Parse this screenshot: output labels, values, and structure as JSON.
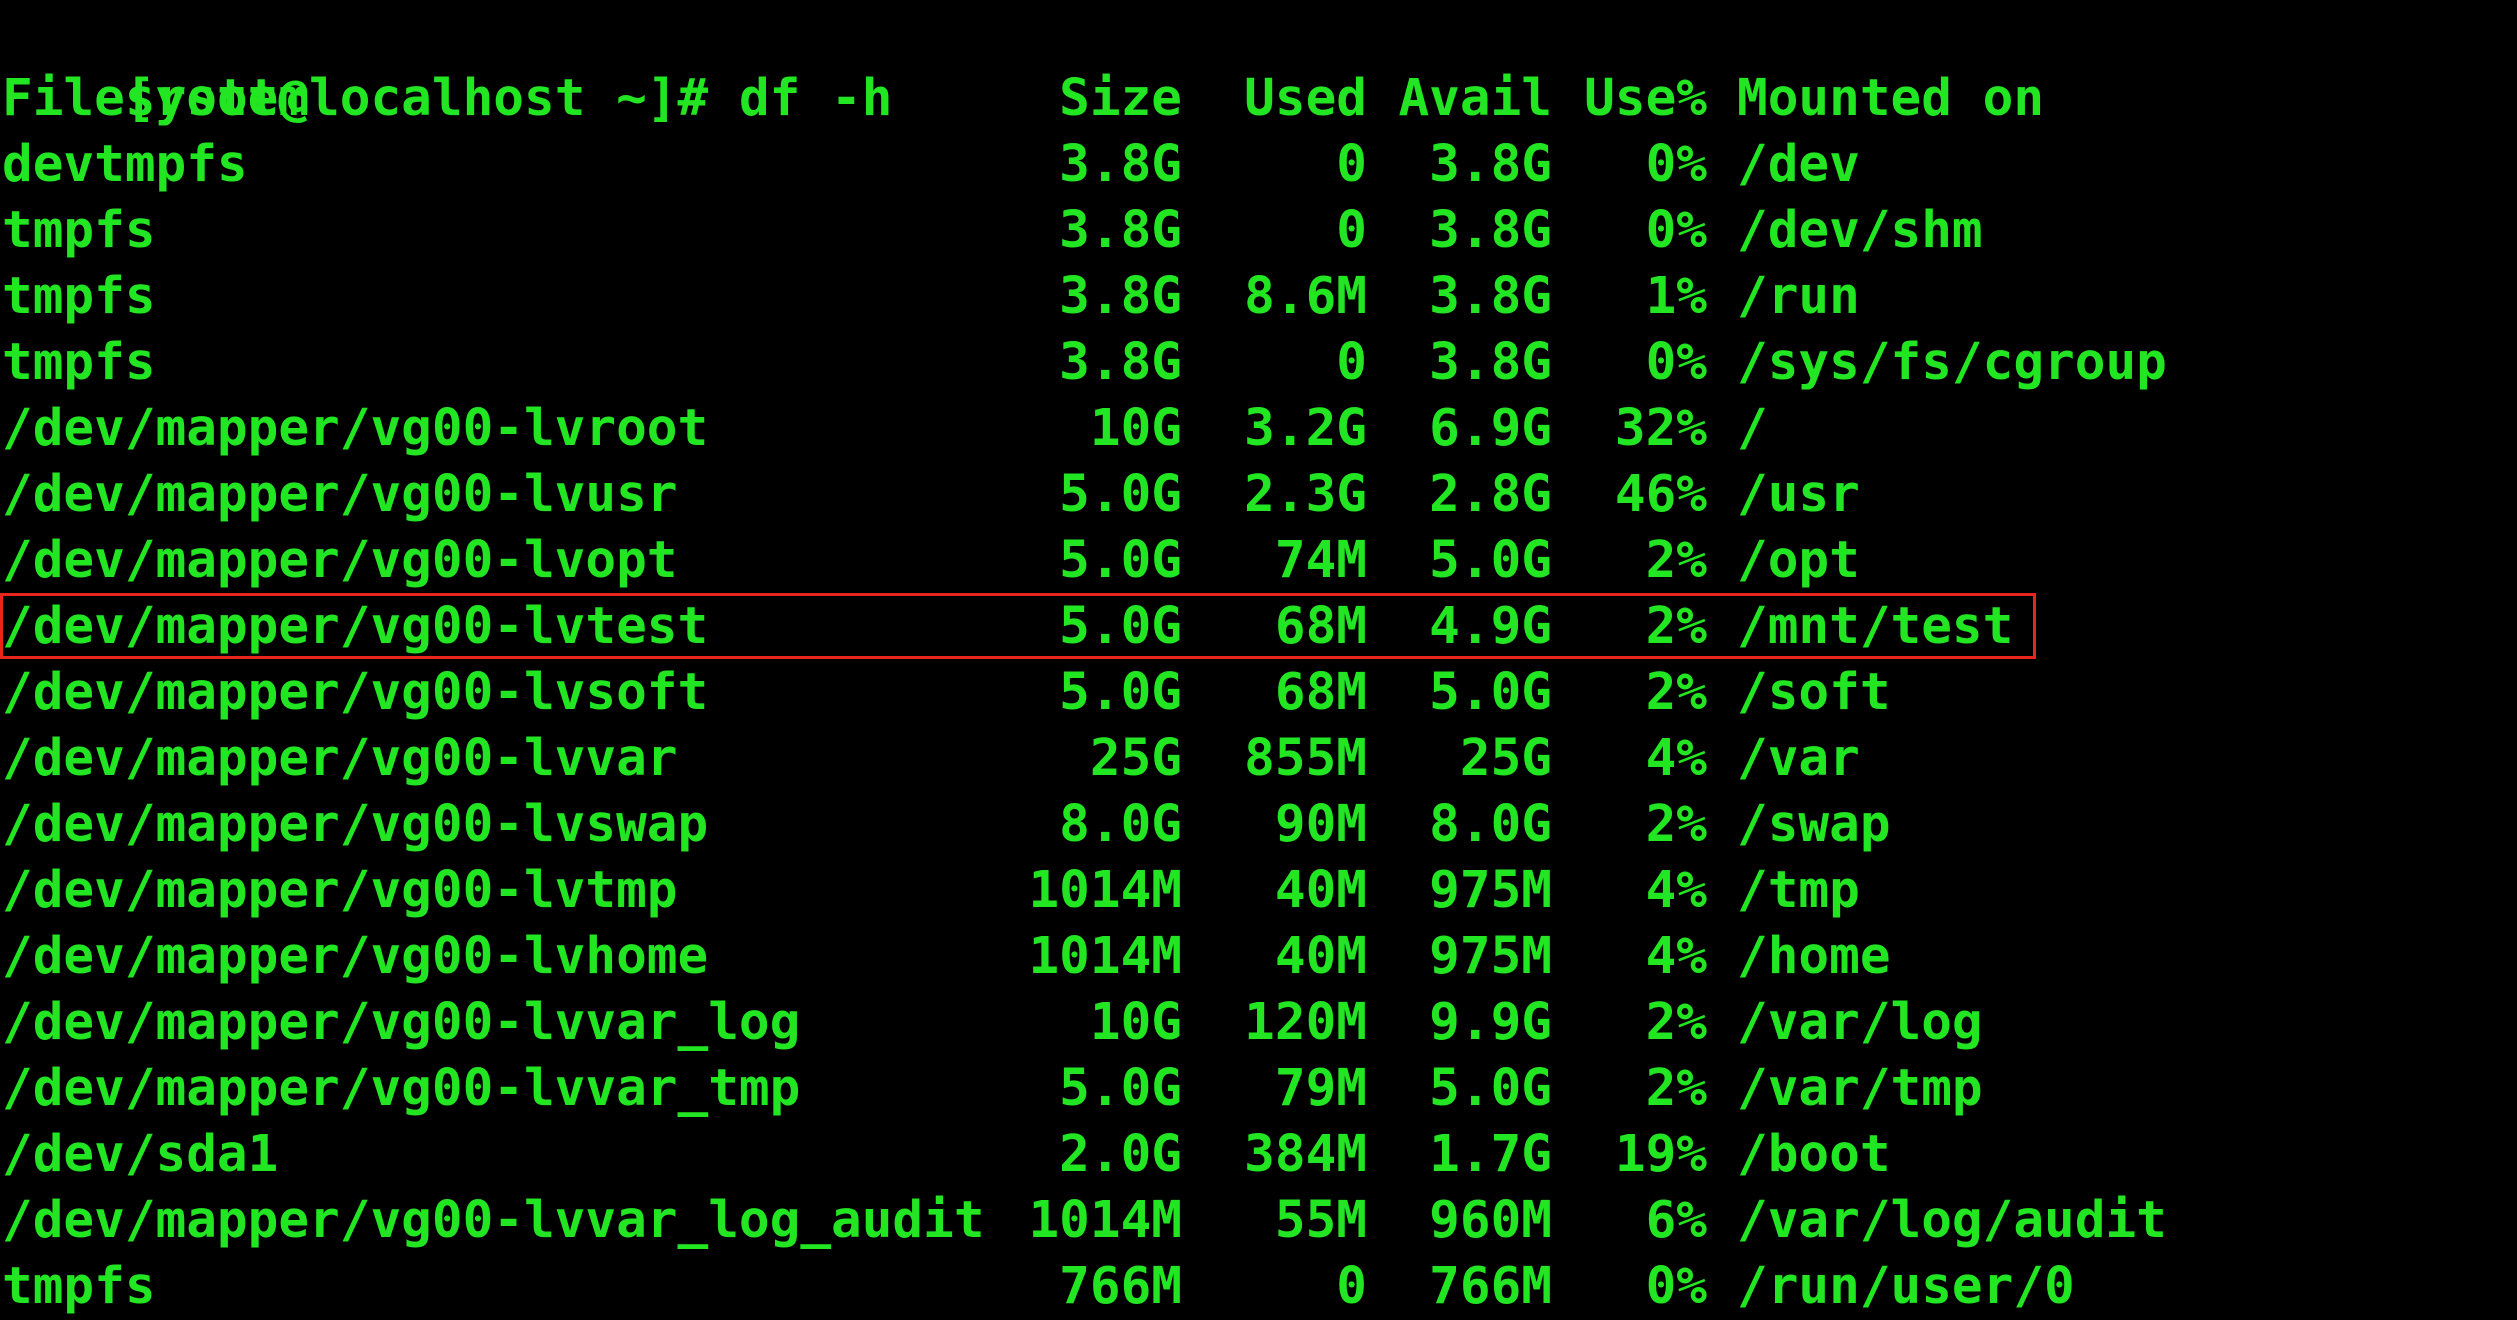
{
  "prompt": {
    "user_host": "[root@localhost ~]#",
    "command": "df -h"
  },
  "header": {
    "filesystem": "Filesystem",
    "size": "Size",
    "used": "Used",
    "avail": "Avail",
    "use_pct": "Use%",
    "mounted_on": "Mounted on"
  },
  "rows": [
    {
      "fs": "devtmpfs",
      "size": "3.8G",
      "used": "0",
      "avail": "3.8G",
      "use": "0%",
      "mount": "/dev"
    },
    {
      "fs": "tmpfs",
      "size": "3.8G",
      "used": "0",
      "avail": "3.8G",
      "use": "0%",
      "mount": "/dev/shm"
    },
    {
      "fs": "tmpfs",
      "size": "3.8G",
      "used": "8.6M",
      "avail": "3.8G",
      "use": "1%",
      "mount": "/run"
    },
    {
      "fs": "tmpfs",
      "size": "3.8G",
      "used": "0",
      "avail": "3.8G",
      "use": "0%",
      "mount": "/sys/fs/cgroup"
    },
    {
      "fs": "/dev/mapper/vg00-lvroot",
      "size": "10G",
      "used": "3.2G",
      "avail": "6.9G",
      "use": "32%",
      "mount": "/"
    },
    {
      "fs": "/dev/mapper/vg00-lvusr",
      "size": "5.0G",
      "used": "2.3G",
      "avail": "2.8G",
      "use": "46%",
      "mount": "/usr"
    },
    {
      "fs": "/dev/mapper/vg00-lvopt",
      "size": "5.0G",
      "used": "74M",
      "avail": "5.0G",
      "use": "2%",
      "mount": "/opt"
    },
    {
      "fs": "/dev/mapper/vg00-lvtest",
      "size": "5.0G",
      "used": "68M",
      "avail": "4.9G",
      "use": "2%",
      "mount": "/mnt/test"
    },
    {
      "fs": "/dev/mapper/vg00-lvsoft",
      "size": "5.0G",
      "used": "68M",
      "avail": "5.0G",
      "use": "2%",
      "mount": "/soft"
    },
    {
      "fs": "/dev/mapper/vg00-lvvar",
      "size": "25G",
      "used": "855M",
      "avail": "25G",
      "use": "4%",
      "mount": "/var"
    },
    {
      "fs": "/dev/mapper/vg00-lvswap",
      "size": "8.0G",
      "used": "90M",
      "avail": "8.0G",
      "use": "2%",
      "mount": "/swap"
    },
    {
      "fs": "/dev/mapper/vg00-lvtmp",
      "size": "1014M",
      "used": "40M",
      "avail": "975M",
      "use": "4%",
      "mount": "/tmp"
    },
    {
      "fs": "/dev/mapper/vg00-lvhome",
      "size": "1014M",
      "used": "40M",
      "avail": "975M",
      "use": "4%",
      "mount": "/home"
    },
    {
      "fs": "/dev/mapper/vg00-lvvar_log",
      "size": "10G",
      "used": "120M",
      "avail": "9.9G",
      "use": "2%",
      "mount": "/var/log"
    },
    {
      "fs": "/dev/mapper/vg00-lvvar_tmp",
      "size": "5.0G",
      "used": "79M",
      "avail": "5.0G",
      "use": "2%",
      "mount": "/var/tmp"
    },
    {
      "fs": "/dev/sda1",
      "size": "2.0G",
      "used": "384M",
      "avail": "1.7G",
      "use": "19%",
      "mount": "/boot"
    },
    {
      "fs": "/dev/mapper/vg00-lvvar_log_audit",
      "size": "1014M",
      "used": "55M",
      "avail": "960M",
      "use": "6%",
      "mount": "/var/log/audit"
    },
    {
      "fs": "tmpfs",
      "size": "766M",
      "used": "0",
      "avail": "766M",
      "use": "0%",
      "mount": "/run/user/0"
    }
  ],
  "highlight": {
    "row_index": 7,
    "color": "#e8241c"
  },
  "colors": {
    "background": "#000000",
    "text": "#22e622"
  }
}
